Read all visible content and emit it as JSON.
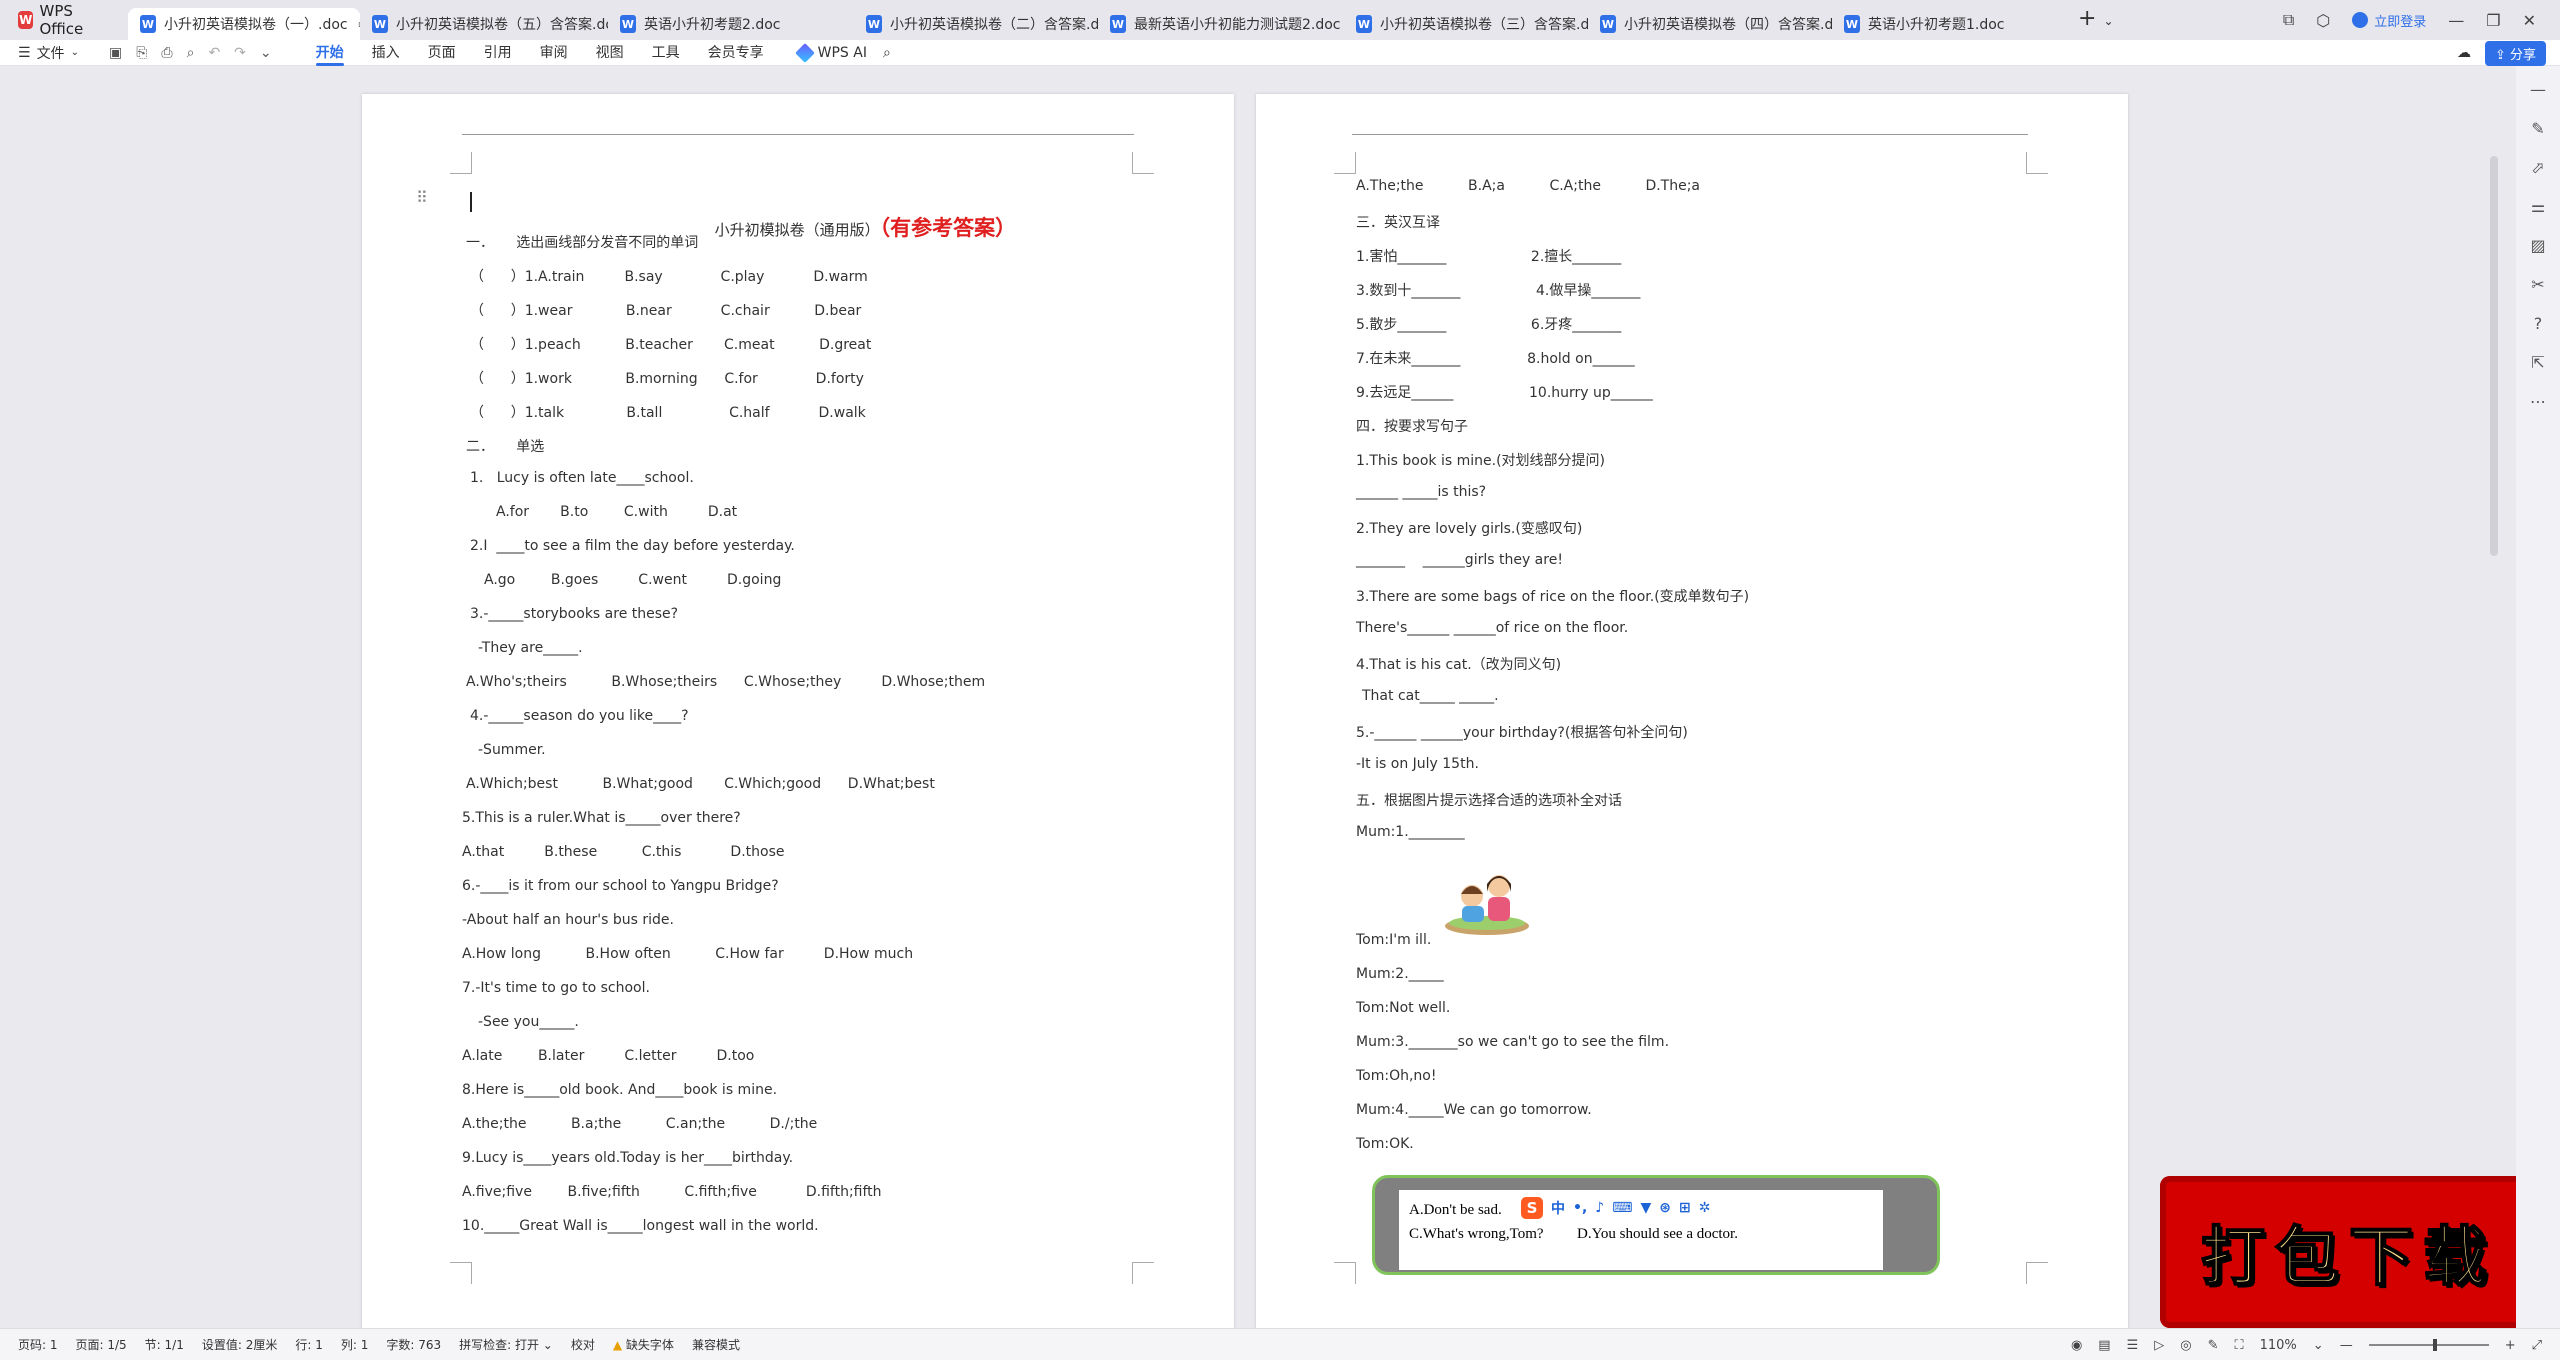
{
  "tabbar": {
    "brand": "WPS Office",
    "tabs": [
      {
        "label": "小升初英语模拟卷（一）.doc",
        "active": true
      },
      {
        "label": "小升初英语模拟卷（五）含答案.doc",
        "active": false
      },
      {
        "label": "英语小升初考题2.doc",
        "active": false
      },
      {
        "label": "小升初英语模拟卷（二）含答案.doc",
        "active": false
      },
      {
        "label": "最新英语小升初能力测试题2.doc",
        "active": false
      },
      {
        "label": "小升初英语模拟卷（三）含答案.doc",
        "active": false
      },
      {
        "label": "小升初英语模拟卷（四）含答案.doc",
        "active": false
      },
      {
        "label": "英语小升初考题1.doc",
        "active": false
      }
    ],
    "login": "立即登录"
  },
  "menubar": {
    "file": "文件",
    "tabs": [
      "开始",
      "插入",
      "页面",
      "引用",
      "审阅",
      "视图",
      "工具",
      "会员专享"
    ],
    "active_tab": "开始",
    "wps_ai": "WPS AI",
    "share": "分享"
  },
  "left_page": {
    "title": "小升初模拟卷（通用版）",
    "title_red": "（有参考答案）",
    "lines": [
      "一．     选出画线部分发音不同的单词",
      "（      ）1.A.train         B.say             C.play           D.warm",
      "（      ）1.wear            B.near           C.chair          D.bear",
      "（      ）1.peach          B.teacher       C.meat          D.great",
      "（      ）1.work            B.morning      C.for             D.forty",
      "（      ）1.talk              B.tall               C.half           D.walk",
      "二．     单选",
      "1.   Lucy is often late____school.",
      "A.for       B.to        C.with         D.at",
      "2.I  ____to see a film the day before yesterday.",
      "A.go        B.goes         C.went         D.going",
      "3.-_____storybooks are these?",
      "-They are_____.",
      "A.Who's;theirs          B.Whose;theirs      C.Whose;they         D.Whose;them",
      "4.-_____season do you like____?",
      "-Summer.",
      "A.Which;best          B.What;good       C.Which;good      D.What;best",
      "5.This is a ruler.What is_____over there?",
      "A.that         B.these          C.this           D.those",
      "6.-____is it from our school to Yangpu Bridge?",
      "-About half an hour's bus ride.",
      "A.How long          B.How often          C.How far         D.How much",
      "7.-It's time to go to school.",
      "-See you_____.",
      "A.late        B.later         C.letter         D.too",
      "8.Here is_____old book. And____book is mine.",
      "A.the;the          B.a;the          C.an;the          D./;the",
      "9.Lucy is____years old.Today is her____birthday.",
      "A.five;five        B.five;fifth          C.fifth;five           D.fifth;fifth",
      "10._____Great Wall is_____longest wall in the world."
    ]
  },
  "right_page": {
    "lines": [
      "A.The;the          B.A;a          C.A;the          D.The;a",
      "三．英汉互译",
      "1.害怕_______                   2.擅长_______",
      "3.数到十_______                 4.做早操_______",
      "5.散步_______                   6.牙疼_______",
      "7.在未来_______               8.hold on______",
      "9.去远足______                 10.hurry up______",
      "四．按要求写句子",
      "1.This book is mine.(对划线部分提问)",
      "______ _____is this?",
      "2.They are lovely girls.(变感叹句)",
      "_______    ______girls they are!",
      "3.There are some bags of rice on the floor.(变成单数句子)",
      "There's______ ______of rice on the floor.",
      "4.That is his cat.（改为同义句)",
      "That cat_____ _____.",
      "5.-______ ______your birthday?(根据答句补全问句)",
      "-It is on July 15th.",
      "五．根据图片提示选择合适的选项补全对话",
      "Mum:1.________",
      "Tom:I'm ill.",
      "Mum:2._____",
      "Tom:Not well.",
      "Mum:3._______so we can't go to see the film.",
      "Tom:Oh,no!",
      "Mum:4._____We can go tomorrow.",
      "Tom:OK."
    ],
    "options": {
      "a": "A.Don't be sad.",
      "c": "C.What's wrong,Tom?",
      "d": "D.You should see a doctor."
    },
    "ime": {
      "logo": "S",
      "mode": "中"
    }
  },
  "download_badge": "打包下载",
  "statusbar": {
    "page": "页码: 1",
    "pages": "页面: 1/5",
    "section": "节: 1/1",
    "setting": "设置值: 2厘米",
    "row": "行: 1",
    "col": "列: 1",
    "words": "字数: 763",
    "spell": "拼写检查: 打开",
    "proof": "校对",
    "missing_font": "缺失字体",
    "compat": "兼容模式",
    "zoom": "110%"
  }
}
